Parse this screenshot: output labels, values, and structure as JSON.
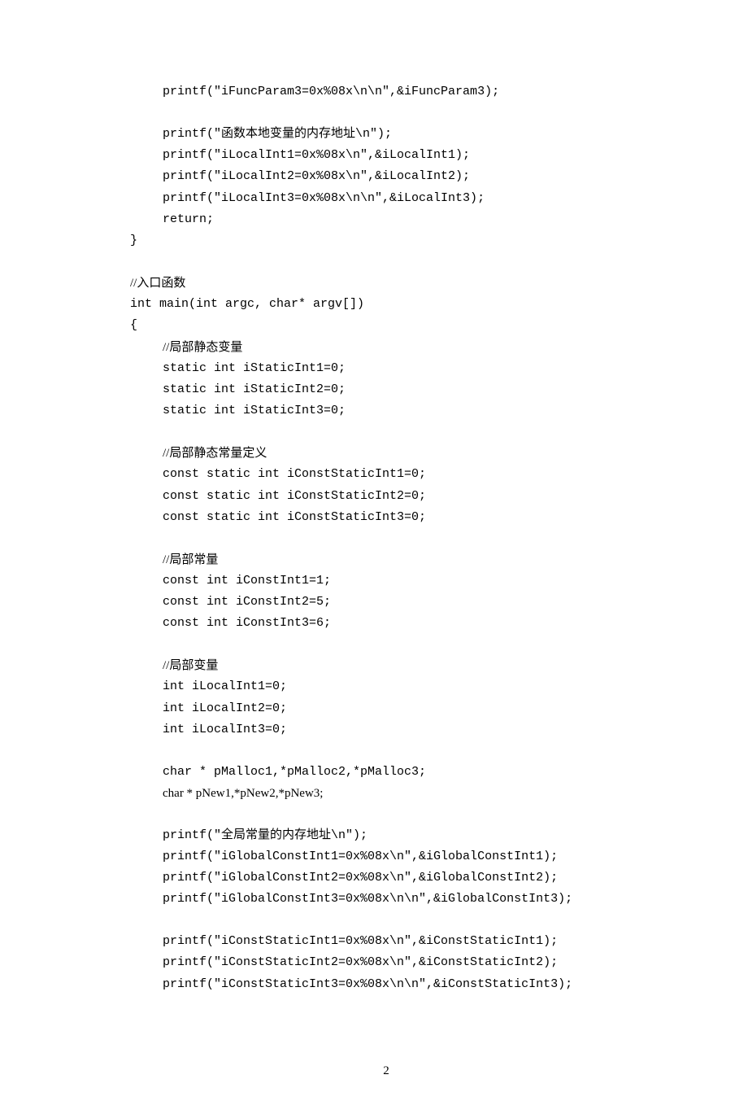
{
  "lines": {
    "l1": "printf(\"iFuncParam3=0x%08x\\n\\n\",&iFuncParam3);",
    "l2": "printf(\"函数本地变量的内存地址\\n\");",
    "l3": "printf(\"iLocalInt1=0x%08x\\n\",&iLocalInt1);",
    "l4": "printf(\"iLocalInt2=0x%08x\\n\",&iLocalInt2);",
    "l5": "printf(\"iLocalInt3=0x%08x\\n\\n\",&iLocalInt3);",
    "l6": "return;",
    "l7": "}",
    "l8": "//入口函数",
    "l9": "int main(int argc, char* argv[])",
    "l10": "{",
    "c1": "//局部静态变量",
    "l11": "static int iStaticInt1=0;",
    "l12": "static int iStaticInt2=0;",
    "l13": "static int iStaticInt3=0;",
    "c2": "//局部静态常量定义",
    "l14": "const static int iConstStaticInt1=0;",
    "l15": "const static int iConstStaticInt2=0;",
    "l16": "const static int iConstStaticInt3=0;",
    "c3": "//局部常量",
    "l17": "const int iConstInt1=1;",
    "l18": "const int iConstInt2=5;",
    "l19": "const int iConstInt3=6;",
    "c4": "//局部变量",
    "l20": "int   iLocalInt1=0;",
    "l21": "int   iLocalInt2=0;",
    "l22": "int   iLocalInt3=0;",
    "l23": "char  * pMalloc1,*pMalloc2,*pMalloc3;",
    "l24": "char    * pNew1,*pNew2,*pNew3;",
    "l25": "printf(\"全局常量的内存地址\\n\");",
    "l26": "printf(\"iGlobalConstInt1=0x%08x\\n\",&iGlobalConstInt1);",
    "l27": "printf(\"iGlobalConstInt2=0x%08x\\n\",&iGlobalConstInt2);",
    "l28": "printf(\"iGlobalConstInt3=0x%08x\\n\\n\",&iGlobalConstInt3);",
    "l29": "printf(\"iConstStaticInt1=0x%08x\\n\",&iConstStaticInt1);",
    "l30": "printf(\"iConstStaticInt2=0x%08x\\n\",&iConstStaticInt2);",
    "l31": "printf(\"iConstStaticInt3=0x%08x\\n\\n\",&iConstStaticInt3);"
  },
  "page_number": "2"
}
